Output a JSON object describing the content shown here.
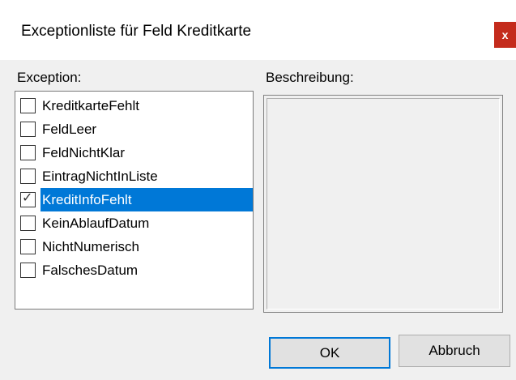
{
  "window": {
    "title": "Exceptionliste für Feld Kreditkarte",
    "close_label": "x"
  },
  "labels": {
    "exception": "Exception:",
    "description": "Beschreibung:"
  },
  "exceptions": [
    {
      "label": "KreditkarteFehlt",
      "checked": false,
      "selected": false
    },
    {
      "label": "FeldLeer",
      "checked": false,
      "selected": false
    },
    {
      "label": "FeldNichtKlar",
      "checked": false,
      "selected": false
    },
    {
      "label": "EintragNichtInListe",
      "checked": false,
      "selected": false
    },
    {
      "label": "KreditInfoFehlt",
      "checked": true,
      "selected": true
    },
    {
      "label": "KeinAblaufDatum",
      "checked": false,
      "selected": false
    },
    {
      "label": "NichtNumerisch",
      "checked": false,
      "selected": false
    },
    {
      "label": "FalschesDatum",
      "checked": false,
      "selected": false
    }
  ],
  "buttons": {
    "ok": "OK",
    "cancel": "Abbruch"
  },
  "colors": {
    "selection": "#0078d7",
    "close_button": "#c42b1c"
  }
}
